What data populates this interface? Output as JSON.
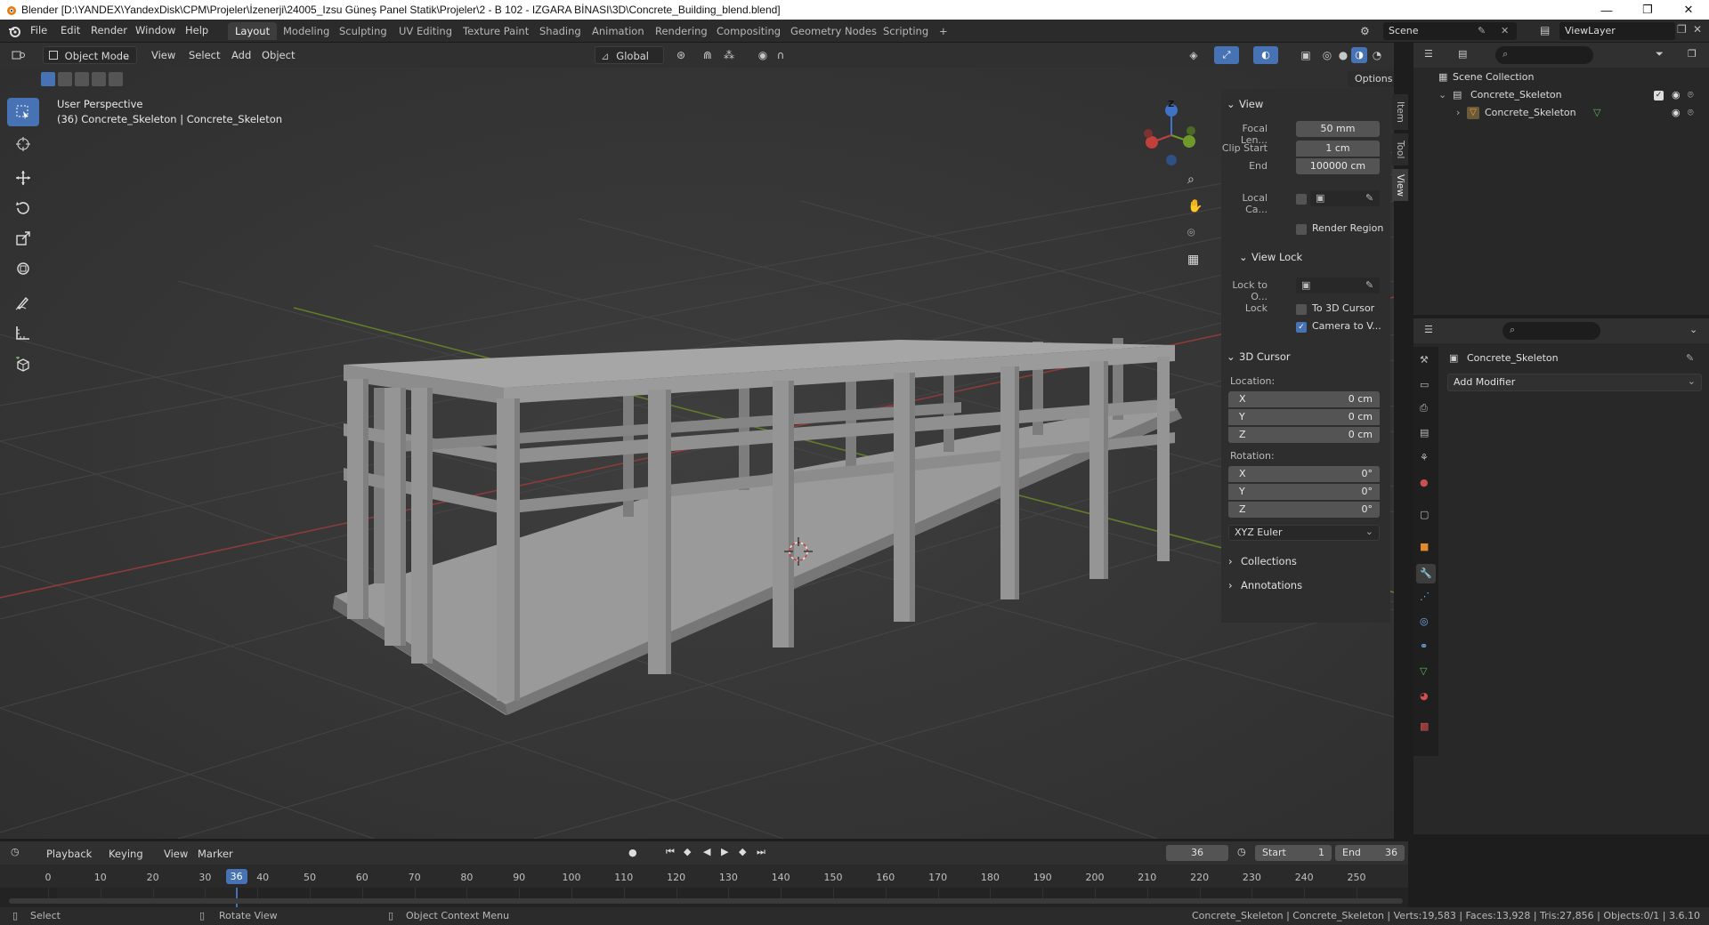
{
  "window": {
    "title": "Blender [D:\\YANDEX\\YandexDisk\\CPM\\Projeler\\İzenerji\\24005_Izsu Güneş Panel Statik\\Projeler\\2 - B 102 - IZGARA BİNASI\\3D\\Concrete_Building_blend.blend]",
    "minimize": "—",
    "restore": "❐",
    "close": "✕"
  },
  "menu": {
    "items": [
      "File",
      "Edit",
      "Render",
      "Window",
      "Help"
    ],
    "workspaces": [
      "Layout",
      "Modeling",
      "Sculpting",
      "UV Editing",
      "Texture Paint",
      "Shading",
      "Animation",
      "Rendering",
      "Compositing",
      "Geometry Nodes",
      "Scripting",
      "+"
    ],
    "active_workspace": "Layout",
    "scene": "Scene",
    "view_layer": "ViewLayer"
  },
  "viewport_header": {
    "mode": "Object Mode",
    "menus": [
      "View",
      "Select",
      "Add",
      "Object"
    ],
    "transform_orientation": "Global",
    "options": "Options"
  },
  "viewport": {
    "perspective": "User Perspective",
    "object_info": "(36) Concrete_Skeleton | Concrete_Skeleton",
    "gizmo": {
      "x": "X",
      "y": "Y",
      "z": "Z"
    }
  },
  "sidebar_tabs": [
    "Item",
    "Tool",
    "View"
  ],
  "n_panel": {
    "view_header": "View",
    "focal_label": "Focal Len...",
    "focal_value": "50 mm",
    "clip_start_label": "Clip Start",
    "clip_start_value": "1 cm",
    "clip_end_label": "End",
    "clip_end_value": "100000 cm",
    "local_camera_label": "Local Ca...",
    "render_region": "Render Region",
    "view_lock_header": "View Lock",
    "lock_to_object_label": "Lock to O...",
    "lock_label": "Lock",
    "to_3d_cursor": "To 3D Cursor",
    "camera_to_view": "Camera to V...",
    "cursor_header": "3D Cursor",
    "location_label": "Location:",
    "loc": [
      {
        "axis": "X",
        "value": "0 cm"
      },
      {
        "axis": "Y",
        "value": "0 cm"
      },
      {
        "axis": "Z",
        "value": "0 cm"
      }
    ],
    "rotation_label": "Rotation:",
    "rot": [
      {
        "axis": "X",
        "value": "0°"
      },
      {
        "axis": "Y",
        "value": "0°"
      },
      {
        "axis": "Z",
        "value": "0°"
      }
    ],
    "rotation_mode": "XYZ Euler",
    "collections": "Collections",
    "annotations": "Annotations"
  },
  "outliner": {
    "root": "Scene Collection",
    "collection": "Concrete_Skeleton",
    "object": "Concrete_Skeleton"
  },
  "properties": {
    "object_name": "Concrete_Skeleton",
    "add_modifier": "Add Modifier"
  },
  "timeline": {
    "menus": [
      "Playback",
      "Keying",
      "View",
      "Marker"
    ],
    "current_frame": "36",
    "start_label": "Start",
    "start_value": "1",
    "end_label": "End",
    "end_value": "36",
    "ticks": [
      "0",
      "10",
      "20",
      "30",
      "40",
      "50",
      "60",
      "70",
      "80",
      "90",
      "100",
      "110",
      "120",
      "130",
      "140",
      "150",
      "160",
      "170",
      "180",
      "190",
      "200",
      "210",
      "220",
      "230",
      "240",
      "250"
    ],
    "tick_values": [
      0,
      10,
      20,
      30,
      40,
      50,
      60,
      70,
      80,
      90,
      100,
      110,
      120,
      130,
      140,
      150,
      160,
      170,
      180,
      190,
      200,
      210,
      220,
      230,
      240,
      250
    ],
    "current_frame_value": 36
  },
  "statusbar": {
    "select": "Select",
    "rotate": "Rotate View",
    "context": "Object Context Menu",
    "stats": "Concrete_Skeleton | Concrete_Skeleton | Verts:19,583 | Faces:13,928 | Tris:27,856 | Objects:0/1 | 3.6.10"
  },
  "colors": {
    "accent": "#4772b3",
    "viewport_bg": "#393939",
    "x_axis": "#c1403c",
    "y_axis": "#6f9a2a",
    "z_axis": "#3f73c7"
  }
}
